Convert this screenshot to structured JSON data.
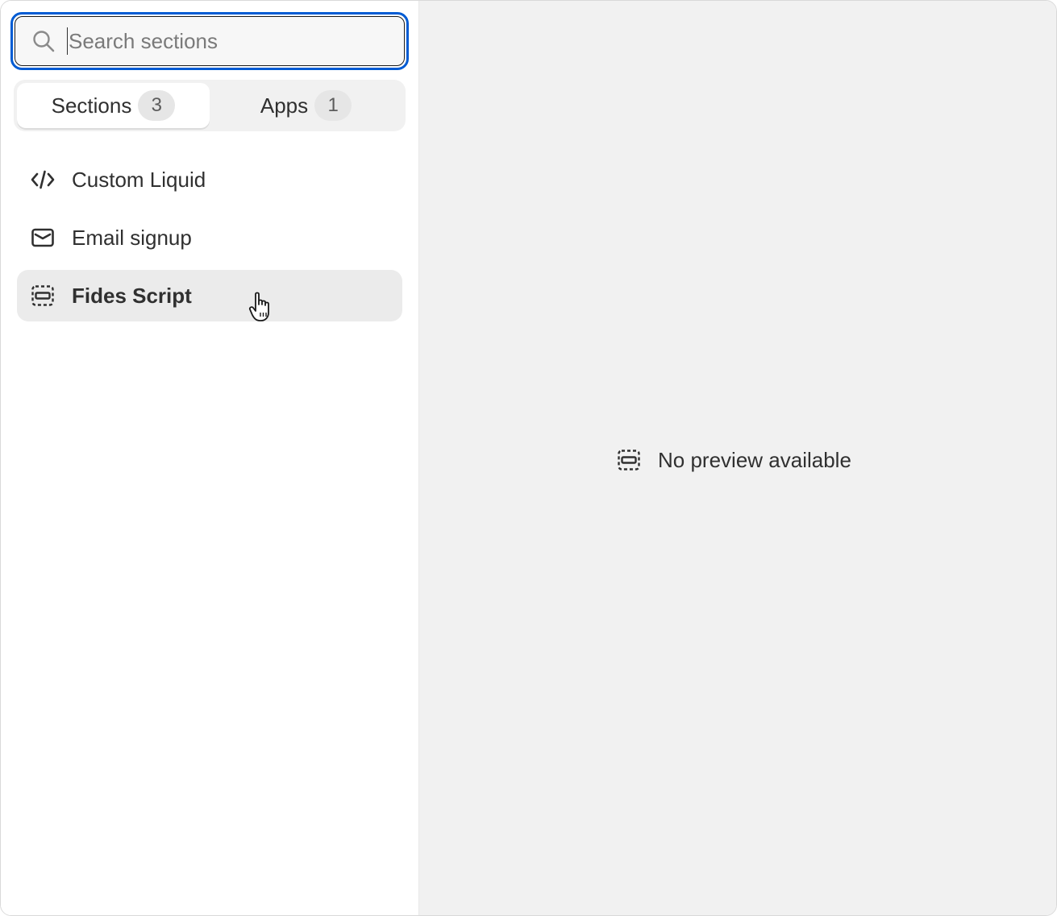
{
  "search": {
    "placeholder": "Search sections",
    "value": ""
  },
  "tabs": [
    {
      "label": "Sections",
      "count": "3",
      "active": true
    },
    {
      "label": "Apps",
      "count": "1",
      "active": false
    }
  ],
  "sections": [
    {
      "label": "Custom Liquid",
      "icon": "code-icon"
    },
    {
      "label": "Email signup",
      "icon": "email-icon"
    },
    {
      "label": "Fides Script",
      "icon": "section-placeholder-icon",
      "hovered": true
    }
  ],
  "preview": {
    "empty_text": "No preview available",
    "icon": "section-placeholder-icon"
  },
  "colors": {
    "focus_ring": "#005bd3",
    "preview_bg": "#f1f1f1",
    "hover_bg": "#ebebeb",
    "text": "#303030"
  }
}
